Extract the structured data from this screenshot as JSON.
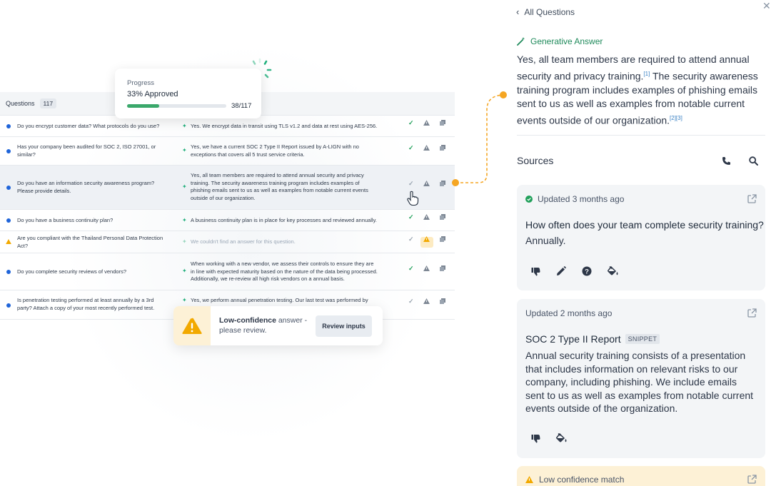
{
  "progress": {
    "label": "Progress",
    "value": "33% Approved",
    "fraction": 0.325,
    "count": "38/117"
  },
  "table": {
    "header": "Questions",
    "count": "117",
    "rows": [
      {
        "q": "Do you encrypt customer data? What protocols do you use?",
        "a": "Yes. We encrypt data in transit using TLS v1.2 and data at rest using AES-256.",
        "status": "approved"
      },
      {
        "q": "Has your company been audited for SOC 2, ISO 27001, or similar?",
        "a": "Yes, we have a current SOC 2 Type II Report issued by A-LIGN with no exceptions that covers all 5 trust service criteria.",
        "status": "approved"
      },
      {
        "q": "Do you have an information security awareness program? Please provide details.",
        "a": "Yes, all team members are required to attend annual security and privacy training. The security awareness training program includes examples of phishing emails sent to us as well as examples from notable current events outside of our organization.",
        "status": "selected"
      },
      {
        "q": "Do you have a business continuity plan?",
        "a": "A business continuity plan is in place for key processes and reviewed annually.",
        "status": "approved"
      },
      {
        "q": "Are you compliant with the Thailand Personal Data Protection Act?",
        "a": "We couldn't find an answer for this question.",
        "status": "warning"
      },
      {
        "q": "Do you complete security reviews of vendors?",
        "a": "When working with a new vendor, we assess their controls to ensure they are in line with expected maturity based on the nature of the data being processed. Additionally, we re-review all high risk vendors on a annual basis.",
        "status": "approved"
      },
      {
        "q": "Is penetration testing performed at least annually by a 3rd party? Attach a copy of your most recently performed test.",
        "a": "Yes, we perform annual penetration testing. Our last test was performed by",
        "status": "pending"
      }
    ]
  },
  "low_confidence": {
    "bold": "Low-confidence",
    "text": " answer - please review.",
    "button": "Review inputs"
  },
  "panel": {
    "back": "All Questions",
    "generative_header": "Generative Answer",
    "answer_p1": "Yes, all team members are required to attend annual security and privacy training.",
    "cite1": "[1]",
    "answer_p2": " The security awareness training program includes examples of phishing emails sent to us as well as examples from notable current events outside of our organization.",
    "cite23": "[2][3]",
    "sources": "Sources",
    "cards": [
      {
        "meta": "Updated 3 months ago",
        "title": "How often does your team complete security training?",
        "body": "Annually."
      },
      {
        "meta": "Updated 2 months ago",
        "title": "SOC 2 Type II Report",
        "tag": "SNIPPET",
        "body": "Annual security training consists of a presentation that includes information on relevant risks to our company, including phishing. We include emails sent to us as well as examples from notable current events outside of the organization."
      }
    ],
    "low_match": "Low confidence match"
  },
  "colors": {
    "accent_green": "#22a05b",
    "brand_blue": "#1f64d9",
    "warning": "#f2a900",
    "connector": "#f5a623"
  }
}
